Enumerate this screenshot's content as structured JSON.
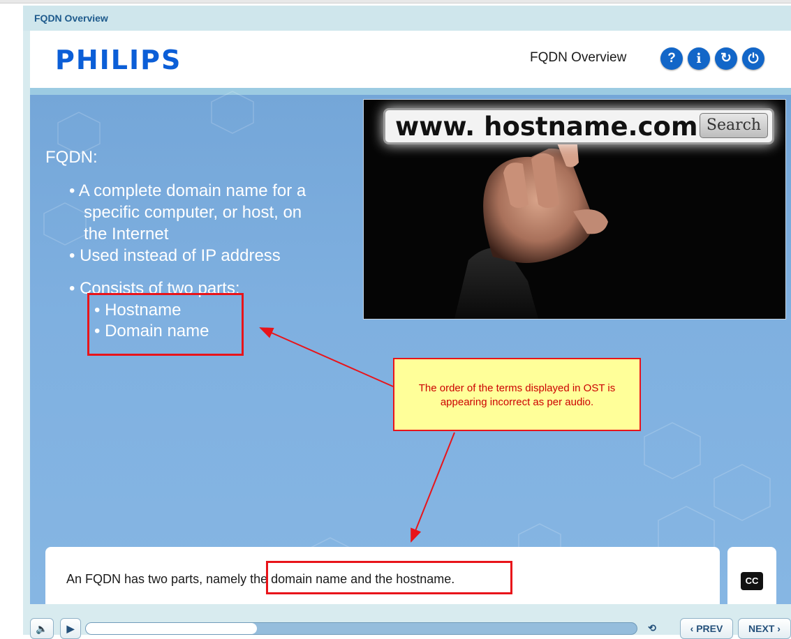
{
  "window": {
    "title": "FQDN Overview"
  },
  "header": {
    "logo": "PHILIPS",
    "course_title": "FQDN Overview",
    "buttons": [
      {
        "icon": "help-icon",
        "glyph": "?"
      },
      {
        "icon": "info-icon",
        "glyph": "i"
      },
      {
        "icon": "replay-icon",
        "glyph": "↻"
      },
      {
        "icon": "power-icon",
        "glyph": "⏻"
      }
    ]
  },
  "slide": {
    "heading": "FQDN:",
    "bullets": [
      "• A complete domain name for a",
      "specific computer, or host, on",
      "the Internet",
      "• Used instead of IP address",
      "• Consists of two parts:"
    ],
    "sub_bullets": [
      "• Hostname",
      "• Domain name"
    ],
    "image": {
      "search_url": "www. hostname.com",
      "search_button": "Search"
    }
  },
  "annotation": {
    "note": "The order of the terms displayed in OST is appearing incorrect as per audio.",
    "colors": {
      "box": "#e8141a",
      "note_bg": "#ffff99"
    }
  },
  "caption": {
    "text_before": "An FQDN has two parts, namely ",
    "text_highlight": "the domain name and the hostname.",
    "cc_label": "CC"
  },
  "controls": {
    "mute_icon": "speaker-icon",
    "play_icon": "play-icon",
    "progress": 0.31,
    "reset_icon": "reload-icon",
    "prev_label": "‹ PREV",
    "next_label": "NEXT ›"
  },
  "colors": {
    "brand": "#0b5ed7",
    "stage": "#7fb0e0",
    "accent_button": "#1266c8"
  }
}
